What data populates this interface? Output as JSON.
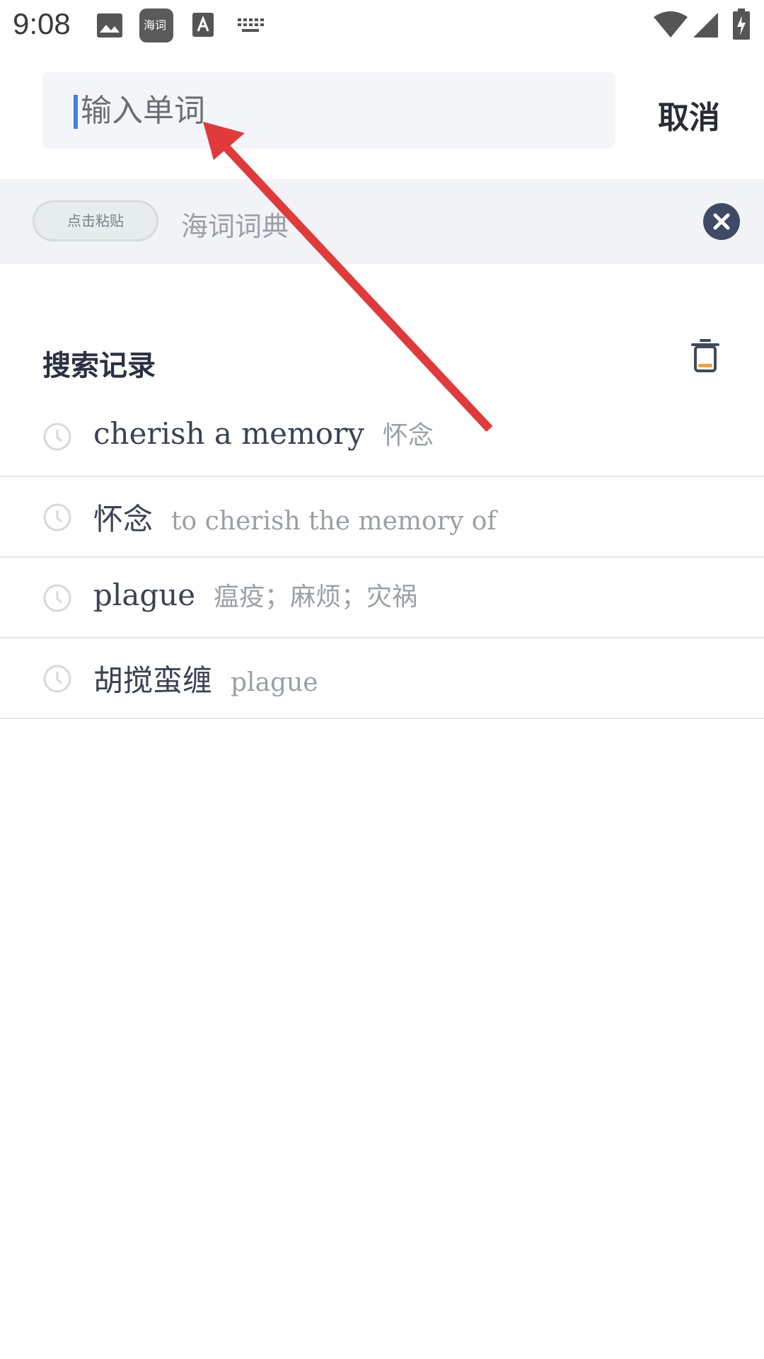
{
  "status_bar": {
    "time": "9:08",
    "app_icon_text": "海词"
  },
  "search": {
    "placeholder": "输入单词",
    "value": "",
    "cancel_label": "取消"
  },
  "clipboard": {
    "paste_label": "点击粘贴",
    "text": "海词词典"
  },
  "history": {
    "title": "搜索记录",
    "items": [
      {
        "word": "cherish a memory",
        "meaning": "怀念"
      },
      {
        "word": "怀念",
        "meaning": "to cherish the memory of"
      },
      {
        "word": "plague",
        "meaning": "瘟疫；麻烦；灾祸"
      },
      {
        "word": "胡搅蛮缠",
        "meaning": "plague"
      }
    ]
  },
  "colors": {
    "accent": "#4a7de0",
    "annotation_arrow": "#e03a3a",
    "close_badge": "#3f4a66"
  }
}
